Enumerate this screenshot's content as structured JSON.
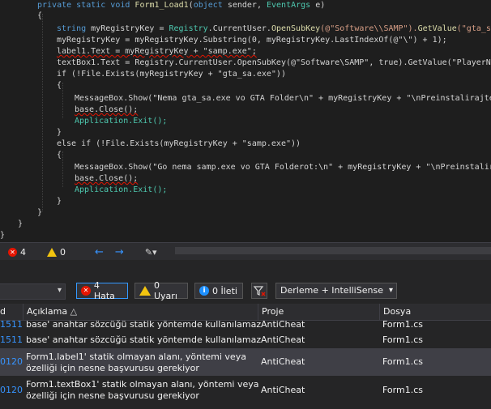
{
  "code": {
    "signature": {
      "mod": "private static void ",
      "name": "Form1_Load1",
      "p1": "(",
      "t1": "object",
      "p2": " sender, ",
      "t2": "EventArgs",
      "p3": " e)"
    },
    "lines": [
      {
        "a": "string ",
        "b": "myRegistryKey",
        "c": " = ",
        "d": "Registry",
        "e": ".CurrentUser.",
        "f": "OpenSubKey",
        "g": "(@\"Software\\\\SAMP\").",
        "h": "GetValue",
        "i": "(\"gta_sa_exe"
      },
      {
        "txt": "myRegistryKey = myRegistryKey.Substring(0, myRegistryKey.LastIndexOf(@\"\\\") + 1);"
      },
      {
        "txt": "label1.Text = myRegistryKey + \"samp.exe\";"
      },
      {
        "txt": "textBox1.Text = Registry.CurrentUser.OpenSubKey(@\"Software\\SAMP\", true).GetValue(\"PlayerName\""
      },
      {
        "txt": "if (!File.Exists(myRegistryKey + \"gta_sa.exe\"))"
      },
      {
        "txt": "MessageBox.Show(\"Nema gta_sa.exe vo GTA Folder\\n\" + myRegistryKey + \"\\nPreinstalirajte go"
      },
      {
        "txt": "base.Close();"
      },
      {
        "txt": "Application.Exit();"
      },
      {
        "txt": "else if (!File.Exists(myRegistryKey + \"samp.exe\"))"
      },
      {
        "txt": "MessageBox.Show(\"Go nema samp.exe vo GTA Folderot:\\n\" + myRegistryKey + \"\\nPreinstalirajt"
      },
      {
        "txt": "base.Close();"
      },
      {
        "txt": "Application.Exit();"
      }
    ],
    "brace_open": "{",
    "brace_close": "}"
  },
  "statusbar": {
    "errors": "4",
    "warnings": "0",
    "back": "←",
    "forward": "→"
  },
  "toolbar": {
    "errors_label": "4 Hata",
    "warnings_label": "0 Uyarı",
    "messages_label": "0 İleti",
    "build_scope": "Derleme + IntelliSense"
  },
  "error_list": {
    "columns": {
      "code": "d",
      "description": "Açıklama",
      "project": "Proje",
      "file": "Dosya"
    },
    "rows": [
      {
        "code": "1511",
        "description": "base' anahtar sözcüğü statik yöntemde kullanılamaz",
        "project": "AntiCheat",
        "file": "Form1.cs"
      },
      {
        "code": "1511",
        "description": "base' anahtar sözcüğü statik yöntemde kullanılamaz",
        "project": "AntiCheat",
        "file": "Form1.cs"
      },
      {
        "code": "0120",
        "description": "Form1.label1' statik olmayan alanı, yöntemi veya",
        "description2": "özelliği için nesne başvurusu gerekiyor",
        "project": "AntiCheat",
        "file": "Form1.cs"
      },
      {
        "code": "0120",
        "description": "Form1.textBox1' statik olmayan alanı, yöntemi veya",
        "description2": "özelliği için nesne başvurusu gerekiyor",
        "project": "AntiCheat",
        "file": "Form1.cs"
      }
    ]
  },
  "colors": {
    "keyword": "#569cd6",
    "type": "#4ec9b0",
    "method": "#dcdcaa",
    "string": "#d69d85",
    "error": "#e51400",
    "warning": "#f2c40f"
  }
}
